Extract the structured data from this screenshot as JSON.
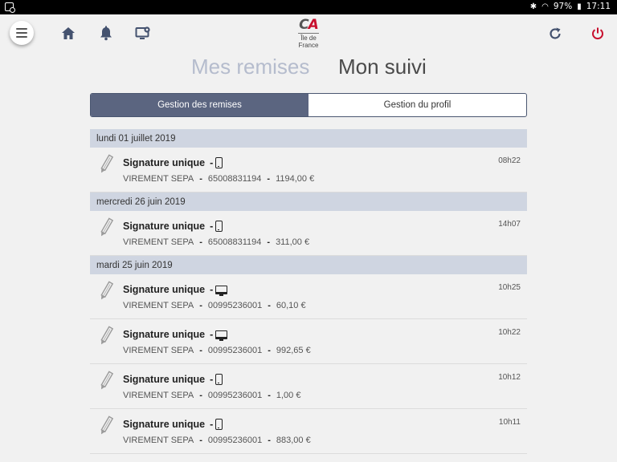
{
  "status_bar": {
    "battery": "97%",
    "time": "17:11"
  },
  "header": {
    "logo_text": "CA",
    "logo_region": "Île de France"
  },
  "section_tabs": [
    {
      "label": "Mes remises",
      "active": false
    },
    {
      "label": "Mon suivi",
      "active": true
    }
  ],
  "segmented": {
    "options": [
      "Gestion des remises",
      "Gestion du profil"
    ],
    "selected": 0
  },
  "groups": [
    {
      "date": "lundi 01 juillet 2019",
      "items": [
        {
          "title": "Signature unique",
          "device": "phone",
          "type": "VIREMENT SEPA",
          "account": "65008831194",
          "amount": "1194,00 €",
          "time": "08h22"
        }
      ]
    },
    {
      "date": "mercredi 26 juin 2019",
      "items": [
        {
          "title": "Signature unique",
          "device": "phone",
          "type": "VIREMENT SEPA",
          "account": "65008831194",
          "amount": "311,00 €",
          "time": "14h07"
        }
      ]
    },
    {
      "date": "mardi 25 juin 2019",
      "items": [
        {
          "title": "Signature unique",
          "device": "desktop",
          "type": "VIREMENT SEPA",
          "account": "00995236001",
          "amount": "60,10 €",
          "time": "10h25"
        },
        {
          "title": "Signature unique",
          "device": "desktop",
          "type": "VIREMENT SEPA",
          "account": "00995236001",
          "amount": "992,65 €",
          "time": "10h22"
        },
        {
          "title": "Signature unique",
          "device": "phone",
          "type": "VIREMENT SEPA",
          "account": "00995236001",
          "amount": "1,00 €",
          "time": "10h12"
        },
        {
          "title": "Signature unique",
          "device": "phone",
          "type": "VIREMENT SEPA",
          "account": "00995236001",
          "amount": "883,00 €",
          "time": "10h11"
        }
      ]
    }
  ],
  "colors": {
    "accent": "#5b6580",
    "date_header": "#cfd5e1",
    "logout": "#c8102e"
  }
}
